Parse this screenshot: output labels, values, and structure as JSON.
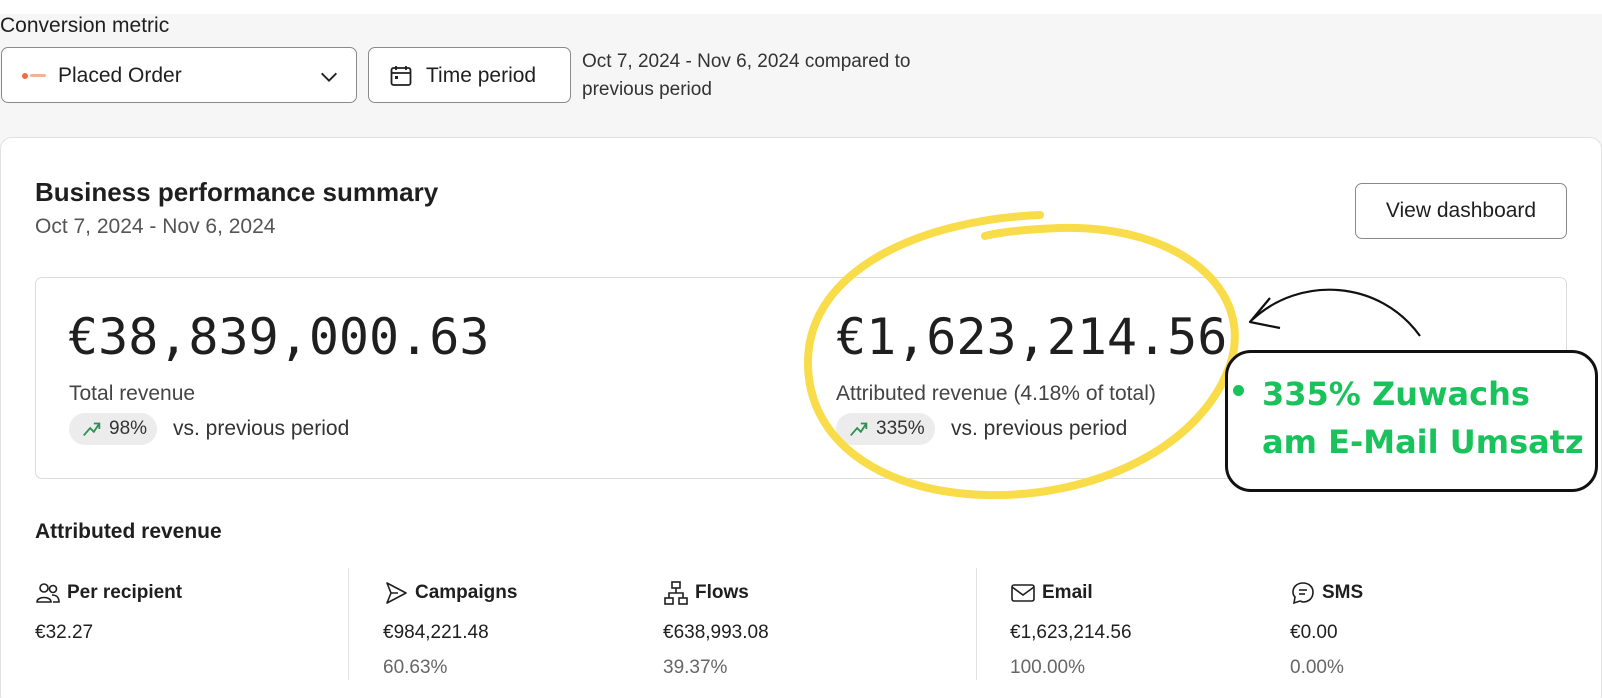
{
  "filters": {
    "metric_label": "Conversion metric",
    "metric_value": "Placed Order",
    "time_button_label": "Time period",
    "period_text": "Oct 7, 2024 - Nov 6, 2024 compared to previous period"
  },
  "summary": {
    "title": "Business performance summary",
    "date_range": "Oct 7, 2024 - Nov 6, 2024",
    "view_dashboard_label": "View dashboard",
    "total": {
      "value": "€38,839,000.63",
      "label": "Total revenue",
      "change": "98%",
      "vs_text": "vs. previous period"
    },
    "attributed": {
      "value": "€1,623,214.56",
      "label": "Attributed revenue (4.18% of total)",
      "change": "335%",
      "vs_text": "vs. previous period"
    }
  },
  "attributed_revenue": {
    "title": "Attributed revenue",
    "columns": [
      {
        "icon": "users-icon",
        "label": "Per recipient",
        "amount": "€32.27",
        "percent": ""
      },
      {
        "icon": "send-icon",
        "label": "Campaigns",
        "amount": "€984,221.48",
        "percent": "60.63%"
      },
      {
        "icon": "flow-icon",
        "label": "Flows",
        "amount": "€638,993.08",
        "percent": "39.37%"
      },
      {
        "icon": "email-icon",
        "label": "Email",
        "amount": "€1,623,214.56",
        "percent": "100.00%"
      },
      {
        "icon": "sms-icon",
        "label": "SMS",
        "amount": "€0.00",
        "percent": "0.00%"
      }
    ]
  },
  "annotation": {
    "line1": "335% Zuwachs",
    "line2": "am E-Mail Umsatz",
    "highlight_color": "#f9dc4a",
    "text_color": "#19c25a"
  },
  "colors": {
    "trend_green": "#2f8f55",
    "page_bg": "#f6f6f7"
  }
}
